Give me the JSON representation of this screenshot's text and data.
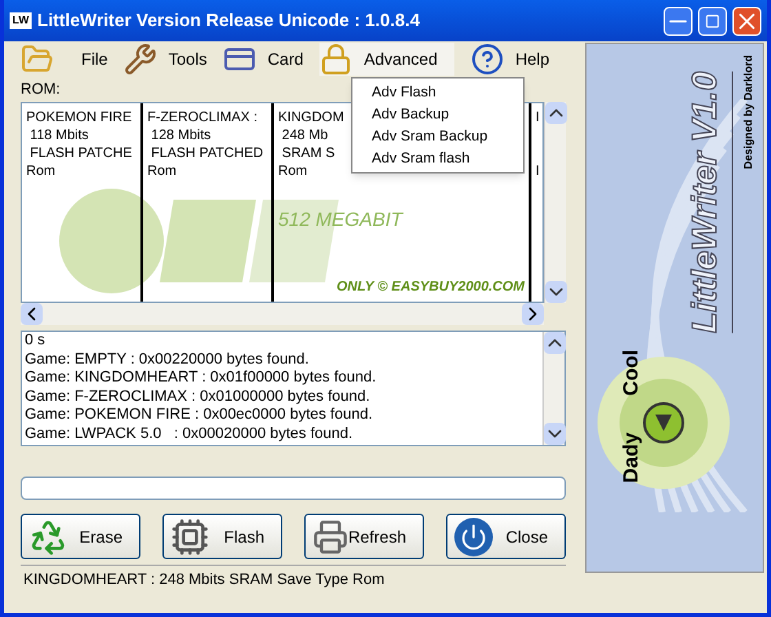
{
  "window": {
    "icon_text": "LW",
    "title": "LittleWriter Version Release Unicode : 1.0.8.4"
  },
  "menu": [
    {
      "label": "File",
      "kind": "folder",
      "expanded": false
    },
    {
      "label": "Tools",
      "kind": "tools",
      "expanded": false
    },
    {
      "label": "Card",
      "kind": "card",
      "expanded": false
    },
    {
      "label": "Advanced",
      "kind": "lock",
      "expanded": true
    },
    {
      "label": "Help",
      "kind": "help",
      "expanded": false
    }
  ],
  "dropdown": [
    "Adv Flash",
    "Adv Backup",
    "Adv Sram Backup",
    "Adv Sram flash"
  ],
  "rom_label": "ROM:",
  "rom_cards": [
    {
      "kind": "full",
      "lines": [
        "POKEMON FIRE",
        " 118 Mbits",
        " FLASH PATCHE",
        "Rom"
      ]
    },
    {
      "kind": "full",
      "lines": [
        "F-ZEROCLIMAX :",
        " 128 Mbits",
        " FLASH PATCHED",
        "Rom"
      ]
    },
    {
      "kind": "full",
      "lines": [
        "KINGDOM",
        " 248 Mb",
        " SRAM S",
        "Rom"
      ],
      "banner": {
        "caption": "512 MEGABIT",
        "credit": "ONLY © EASYBUY2000.COM"
      }
    },
    {
      "kind": "partial",
      "lines": [
        "I",
        "I"
      ]
    }
  ],
  "log": [
    "0 s",
    "Game: EMPTY : 0x00220000 bytes found.",
    "Game: KINGDOMHEART : 0x01f00000 bytes found.",
    "Game: F-ZEROCLIMAX : 0x01000000 bytes found.",
    "Game: POKEMON FIRE : 0x00ec0000 bytes found.",
    "Game: LWPACK 5.0   : 0x00020000 bytes found."
  ],
  "progress": {
    "level": 0
  },
  "buttons": [
    {
      "label": "Erase",
      "kind": "erase"
    },
    {
      "label": "Flash",
      "kind": "flash"
    },
    {
      "label": "Refresh",
      "kind": "refresh"
    },
    {
      "label": "Close",
      "kind": "close"
    }
  ],
  "status_bar": "KINGDOMHEART : 248 Mbits SRAM Save Type Rom",
  "side_panel": {
    "title": "LittleWriter V1.0",
    "credit": "Designed by Darklord",
    "badge_left": "Dady",
    "badge_right": "Cool"
  }
}
